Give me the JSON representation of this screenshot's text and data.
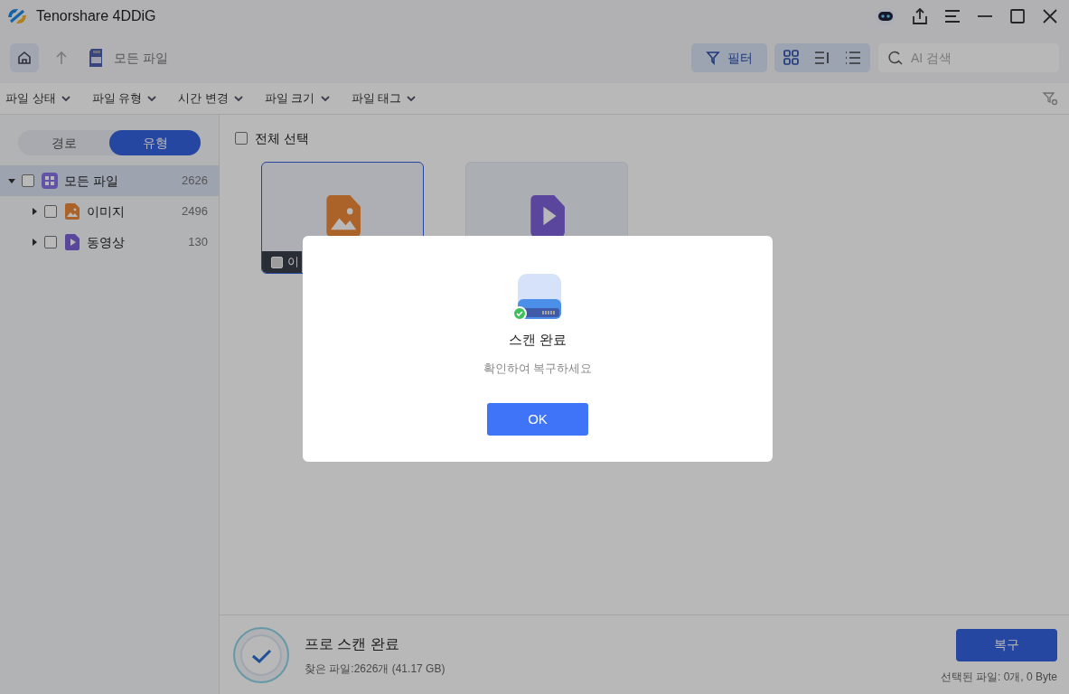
{
  "window": {
    "title": "Tenorshare 4DDiG"
  },
  "breadcrumb": {
    "label": "모든 파일"
  },
  "filter_button": {
    "label": "필터",
    "selected": true
  },
  "view_modes": [
    {
      "kind": "grid",
      "selected": true
    },
    {
      "kind": "detail",
      "selected": false
    },
    {
      "kind": "list",
      "selected": false
    }
  ],
  "search": {
    "placeholder": "AI 검색"
  },
  "filters": [
    "파일 상태",
    "파일 유형",
    "시간 변경",
    "파일 크기",
    "파일 태그"
  ],
  "sidebar_tabs": [
    {
      "label": "경로",
      "selected": false
    },
    {
      "label": "유형",
      "selected": true
    }
  ],
  "tree": [
    {
      "label": "모든 파일",
      "count": "2626",
      "kind": "all",
      "checked": false,
      "expanded": true,
      "selected": true,
      "children": [
        {
          "label": "이미지",
          "count": "2496",
          "kind": "image",
          "checked": false,
          "expanded": false,
          "selected": false
        },
        {
          "label": "동영상",
          "count": "130",
          "kind": "video",
          "checked": false,
          "expanded": false,
          "selected": false
        }
      ]
    }
  ],
  "select_all": {
    "label": "전체 선택",
    "checked": false
  },
  "cards": [
    {
      "kind": "image",
      "label": "이",
      "selected": true,
      "checked": false
    },
    {
      "kind": "video",
      "selected": false
    }
  ],
  "dialog": {
    "title": "스캔 완료",
    "message": "확인하여 복구하세요",
    "button": "OK"
  },
  "status": {
    "title": "프로 스캔 완료",
    "detail": "찾은 파일:2626개 (41.17 GB)",
    "recover_button": "복구",
    "selected_info": "선택된 파일: 0개, 0 Byte"
  }
}
